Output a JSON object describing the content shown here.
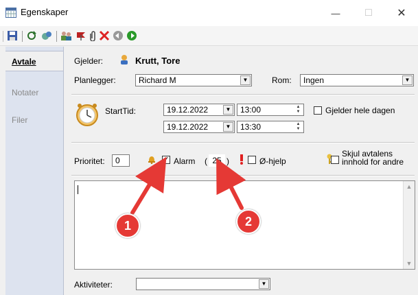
{
  "window": {
    "title": "Egenskaper",
    "minimize": "—",
    "maximize": "□",
    "close": "✕"
  },
  "tabs": [
    {
      "label": "Avtale",
      "active": true
    },
    {
      "label": "Notater",
      "active": false
    },
    {
      "label": "Filer",
      "active": false
    }
  ],
  "form": {
    "gjelder_label": "Gjelder:",
    "gjelder_value": "Krutt, Tore",
    "planlegger_label": "Planlegger:",
    "planlegger_value": "Richard M",
    "rom_label": "Rom:",
    "rom_value": "Ingen",
    "starttid_label": "StartTid:",
    "start_date": "19.12.2022",
    "start_time": "13:00",
    "end_date": "19.12.2022",
    "end_time": "13:30",
    "hele_dagen_label": "Gjelder hele dagen",
    "prioritet_label": "Prioritet:",
    "prioritet_value": "0",
    "alarm_label": "Alarm",
    "alarm_checked": true,
    "alarm_minutes": "25",
    "ohjelp_label": "Ø-hjelp",
    "skjul_label_1": "Skjul avtalens",
    "skjul_label_2": "innhold for andre",
    "aktiviteter_label": "Aktiviteter:",
    "aktiviteter_value": ""
  },
  "annotations": [
    "1",
    "2"
  ],
  "colors": {
    "annotation": "#e53935",
    "tab_strip": "#dde3ef"
  }
}
